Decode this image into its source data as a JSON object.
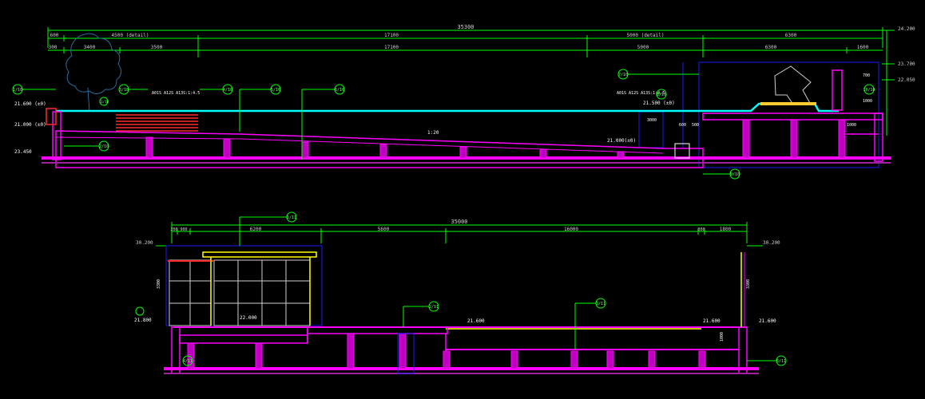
{
  "sections": {
    "top": {
      "dims": {
        "overall": "35300",
        "row1": [
          "600",
          "4500 (detail)",
          "17100",
          "5000 (detail)",
          "6300"
        ],
        "row2": [
          "3400",
          "3500",
          "17100",
          "5000",
          "6300",
          "1600"
        ],
        "small_left": [
          "500",
          "300"
        ],
        "right_levels": [
          "24.200",
          "23.700",
          "22.050"
        ]
      },
      "levels": [
        "21.600 (±0)",
        "21.000 (±0)",
        "21.000(±0)",
        "21.500 (±0)",
        "23.450"
      ],
      "slope": "1:20",
      "callouts": [
        "1/10",
        "2/10",
        "3/10",
        "4/10",
        "5/10",
        "6/10",
        "7/10",
        "8/10",
        "9/10",
        "10/10",
        "11/10"
      ],
      "notes": [
        "A01S A12S A13S:1:4.5",
        "A01S A12S A13S:1:4.5"
      ],
      "inner_dims": [
        "3000",
        "600",
        "500",
        "1000",
        "700",
        "1000"
      ]
    },
    "bottom": {
      "dims": {
        "overall": "35000",
        "row1": [
          "200",
          "900",
          "6200",
          "5600",
          "16000",
          "300",
          "1800"
        ],
        "levels": [
          "30.200",
          "30.200"
        ]
      },
      "levels": [
        "22.000",
        "21.800",
        "21.600",
        "21.600",
        "21.600"
      ],
      "callouts": [
        "1/11",
        "2/11",
        "3/11",
        "4/11",
        "5/11"
      ],
      "inner_dims": [
        "3300",
        "3300",
        "1000"
      ]
    }
  },
  "colors": {
    "background": "#000000",
    "dimension": "#00ff00",
    "structure": "#ff00ff",
    "water": "#00ffff",
    "guide": "#0000ff",
    "annotation": "#ffff00",
    "wood": "#ff3030",
    "text": "#ffffff"
  }
}
